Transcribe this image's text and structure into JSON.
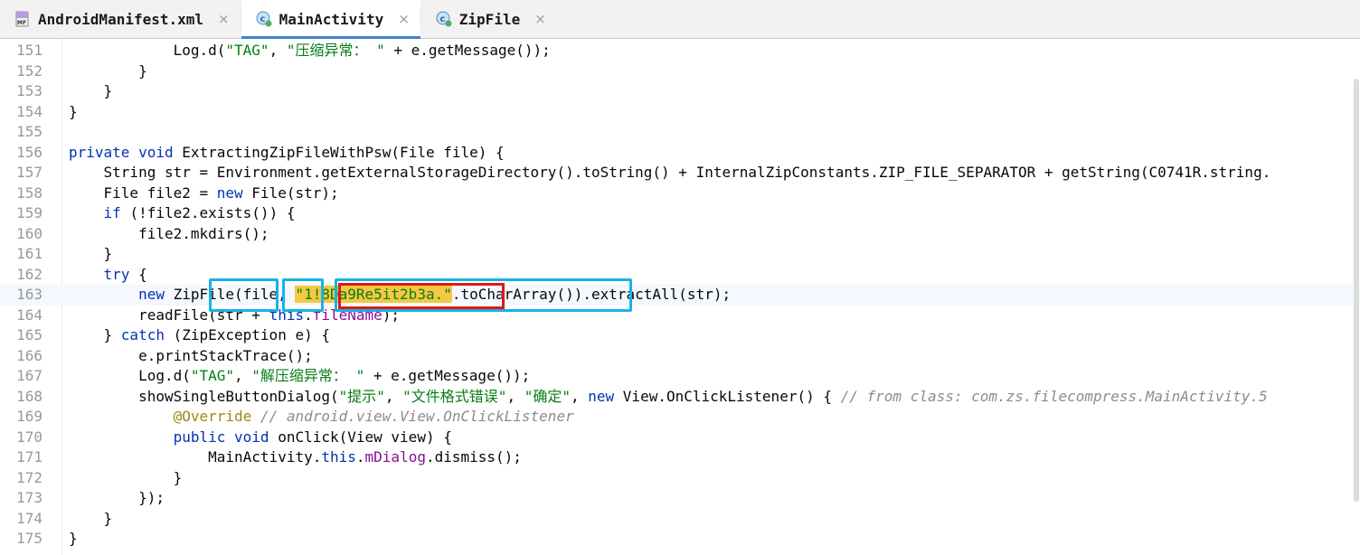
{
  "tabs": [
    {
      "label": "AndroidManifest.xml",
      "icon": "manifest-file-icon",
      "active": false
    },
    {
      "label": "MainActivity",
      "icon": "java-class-icon",
      "active": true
    },
    {
      "label": "ZipFile",
      "icon": "java-class-icon",
      "active": false
    }
  ],
  "close_glyph": "×",
  "lines": [
    {
      "num": "151",
      "segs": [
        [
          "",
          "            Log.d("
        ],
        [
          "str",
          "\"TAG\""
        ],
        [
          "",
          ", "
        ],
        [
          "str",
          "\"压缩异常： \""
        ],
        [
          "",
          " + e.getMessage());"
        ]
      ]
    },
    {
      "num": "152",
      "segs": [
        [
          "",
          "        }"
        ]
      ]
    },
    {
      "num": "153",
      "segs": [
        [
          "",
          "    }"
        ]
      ]
    },
    {
      "num": "154",
      "segs": [
        [
          "",
          "}"
        ]
      ]
    },
    {
      "num": "155",
      "segs": [
        [
          "",
          ""
        ]
      ]
    },
    {
      "num": "156",
      "segs": [
        [
          "kw",
          "private void "
        ],
        [
          "",
          "ExtractingZipFileWithPsw(File file) {"
        ]
      ]
    },
    {
      "num": "157",
      "segs": [
        [
          "",
          "    String str = Environment.getExternalStorageDirectory().toString() + InternalZipConstants.ZIP_FILE_SEPARATOR + getString(C0741R.string."
        ]
      ]
    },
    {
      "num": "158",
      "segs": [
        [
          "",
          "    File file2 = "
        ],
        [
          "kw",
          "new "
        ],
        [
          "",
          "File(str);"
        ]
      ]
    },
    {
      "num": "159",
      "segs": [
        [
          "",
          "    "
        ],
        [
          "kw",
          "if "
        ],
        [
          "",
          "(!file2.exists()) {"
        ]
      ]
    },
    {
      "num": "160",
      "segs": [
        [
          "",
          "        file2.mkdirs();"
        ]
      ]
    },
    {
      "num": "161",
      "segs": [
        [
          "",
          "    }"
        ]
      ]
    },
    {
      "num": "162",
      "segs": [
        [
          "",
          "    "
        ],
        [
          "kw",
          "try "
        ],
        [
          "",
          "{"
        ]
      ]
    },
    {
      "num": "163",
      "segs": [
        [
          "",
          "        "
        ],
        [
          "kw",
          "new "
        ],
        [
          "",
          "ZipFile(file, "
        ],
        [
          "hlstr",
          "\"1!8Da9Re5it2b3a.\""
        ],
        [
          "",
          ".toCharArray()).extractAll(str);"
        ]
      ]
    },
    {
      "num": "164",
      "segs": [
        [
          "",
          "        readFile(str + "
        ],
        [
          "kw",
          "this"
        ],
        [
          "",
          "."
        ],
        [
          "fld",
          "fileName"
        ],
        [
          "",
          ");"
        ]
      ]
    },
    {
      "num": "165",
      "segs": [
        [
          "",
          "    } "
        ],
        [
          "kw",
          "catch "
        ],
        [
          "",
          "(ZipException e) {"
        ]
      ]
    },
    {
      "num": "166",
      "segs": [
        [
          "",
          "        e.printStackTrace();"
        ]
      ]
    },
    {
      "num": "167",
      "segs": [
        [
          "",
          "        Log.d("
        ],
        [
          "str",
          "\"TAG\""
        ],
        [
          "",
          ", "
        ],
        [
          "str",
          "\"解压缩异常： \""
        ],
        [
          "",
          " + e.getMessage());"
        ]
      ]
    },
    {
      "num": "168",
      "segs": [
        [
          "",
          "        showSingleButtonDialog("
        ],
        [
          "str",
          "\"提示\""
        ],
        [
          "",
          ", "
        ],
        [
          "str",
          "\"文件格式错误\""
        ],
        [
          "",
          ", "
        ],
        [
          "str",
          "\"确定\""
        ],
        [
          "",
          ", "
        ],
        [
          "kw",
          "new "
        ],
        [
          "",
          "View.OnClickListener() { "
        ],
        [
          "cmt",
          "// from class: com.zs.filecompress.MainActivity.5"
        ]
      ]
    },
    {
      "num": "169",
      "segs": [
        [
          "",
          "            "
        ],
        [
          "ann",
          "@Override "
        ],
        [
          "cmt",
          "// android.view.View.OnClickListener"
        ]
      ]
    },
    {
      "num": "170",
      "segs": [
        [
          "",
          "            "
        ],
        [
          "kw",
          "public void "
        ],
        [
          "",
          "onClick(View view) {"
        ]
      ]
    },
    {
      "num": "171",
      "segs": [
        [
          "",
          "                MainActivity."
        ],
        [
          "kw",
          "this"
        ],
        [
          "",
          "."
        ],
        [
          "fld",
          "mDialog"
        ],
        [
          "",
          ".dismiss();"
        ]
      ]
    },
    {
      "num": "172",
      "segs": [
        [
          "",
          "            }"
        ]
      ]
    },
    {
      "num": "173",
      "segs": [
        [
          "",
          "        });"
        ]
      ]
    },
    {
      "num": "174",
      "segs": [
        [
          "",
          "    }"
        ]
      ]
    },
    {
      "num": "175",
      "segs": [
        [
          "",
          "}"
        ]
      ]
    }
  ],
  "colors": {
    "keyword": "#0033b3",
    "string": "#067d17",
    "comment": "#8c8c8c",
    "annotation": "#9e880d",
    "field": "#871094",
    "highlight_box": "#17b2e6",
    "password_box": "#e01818",
    "string_highlight": "#f4c842"
  }
}
